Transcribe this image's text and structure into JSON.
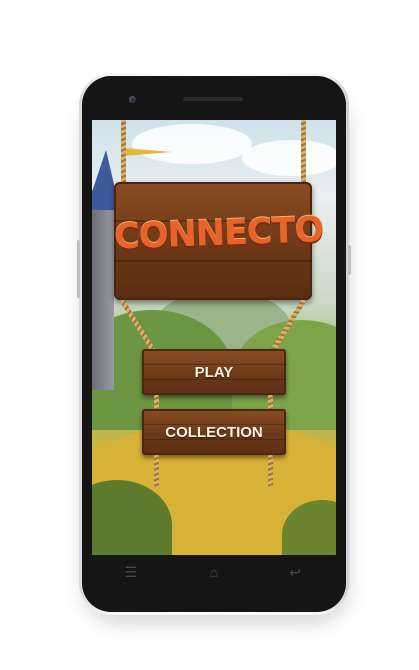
{
  "game": {
    "logo_text": "CONNECTO",
    "play_label": "PLAY",
    "collection_label": "COLLECTION"
  },
  "device": {
    "nav_icons": [
      "menu-icon",
      "home-icon",
      "back-icon"
    ]
  },
  "colors": {
    "wood": "#6c391a",
    "logo": "#e8632a",
    "button_text": "#fff6e6",
    "device_body": "#ffffff",
    "bezel": "#151515"
  }
}
